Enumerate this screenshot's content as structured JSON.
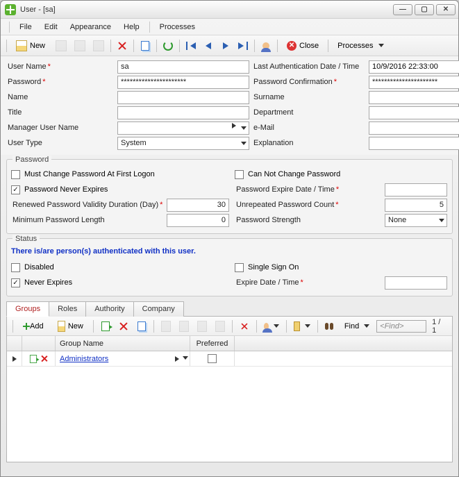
{
  "window": {
    "title": "User - [sa]"
  },
  "menubar": {
    "file": "File",
    "edit": "Edit",
    "appearance": "Appearance",
    "help": "Help",
    "processes": "Processes"
  },
  "toolbar": {
    "new": "New",
    "close": "Close",
    "processes": "Processes"
  },
  "form": {
    "user_name_lbl": "User Name",
    "user_name": "sa",
    "last_auth_lbl": "Last Authentication Date / Time",
    "last_auth": "10/9/2016 22:33:00",
    "password_lbl": "Password",
    "password": "**********************",
    "password_conf_lbl": "Password Confirmation",
    "password_conf": "**********************",
    "name_lbl": "Name",
    "name": "",
    "surname_lbl": "Surname",
    "surname": "",
    "title_lbl": "Title",
    "title": "",
    "department_lbl": "Department",
    "department": "",
    "manager_lbl": "Manager User Name",
    "manager": "",
    "email_lbl": "e-Mail",
    "email": "",
    "user_type_lbl": "User Type",
    "user_type": "System",
    "explanation_lbl": "Explanation",
    "explanation": ""
  },
  "password_section": {
    "legend": "Password",
    "must_change": "Must Change Password At First Logon",
    "must_change_checked": false,
    "cannot_change": "Can Not Change Password",
    "cannot_change_checked": false,
    "never_expires": "Password Never Expires",
    "never_expires_checked": true,
    "expire_date_lbl": "Password Expire Date / Time",
    "expire_date": "",
    "renewed_lbl": "Renewed Password Validity Duration (Day)",
    "renewed": "30",
    "unrepeated_lbl": "Unrepeated Password Count",
    "unrepeated": "5",
    "min_len_lbl": "Minimum Password Length",
    "min_len": "0",
    "strength_lbl": "Password Strength",
    "strength": "None"
  },
  "status_section": {
    "legend": "Status",
    "message": "There is/are person(s) authenticated with this user.",
    "disabled": "Disabled",
    "disabled_checked": false,
    "sso": "Single Sign On",
    "sso_checked": false,
    "never_expires": "Never Expires",
    "never_expires_checked": true,
    "expire_lbl": "Expire Date / Time",
    "expire": ""
  },
  "tabs": {
    "groups": "Groups",
    "roles": "Roles",
    "authority": "Authority",
    "company": "Company",
    "active": "groups"
  },
  "groups_toolbar": {
    "add": "Add",
    "new": "New",
    "find": "Find",
    "find_placeholder": "<Find>",
    "pager": "1 / 1"
  },
  "groups_grid": {
    "col_group_name": "Group Name",
    "col_preferred": "Preferred",
    "rows": [
      {
        "name": "Administrators",
        "preferred": false
      }
    ]
  }
}
